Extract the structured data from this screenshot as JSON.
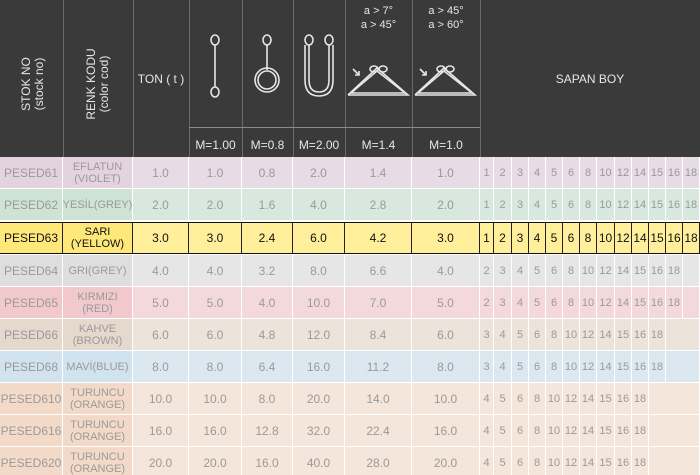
{
  "header": {
    "stok_no": "STOK NO",
    "stok_no_en": "(stock no)",
    "renk_kodu": "RENK KODU",
    "renk_kodu_en": "(color cod)",
    "ton": "TON ( t )",
    "angle_a1": "a > 7°",
    "angle_a2": "a > 45°",
    "angle_b1": "a > 45°",
    "angle_b2": "a > 60°",
    "sapan_boy": "SAPAN BOY",
    "m_values": [
      "M=1.00",
      "M=0.8",
      "M=2.00",
      "M=1.4",
      "M=1.0"
    ]
  },
  "colors": {
    "header_bg": "#3a3a3a",
    "highlight_bg": "#ffe87a",
    "highlight_border": "#111111"
  },
  "rows": [
    {
      "stock": "PESED61",
      "color1": "EFLATUN",
      "color2": "(VIOLET)",
      "ton": "1.0",
      "m": [
        "1.0",
        "0.8",
        "2.0",
        "1.4",
        "1.0"
      ],
      "lengths": [
        "1",
        "2",
        "3",
        "4",
        "5",
        "6",
        "8",
        "10",
        "12",
        "14",
        "15",
        "16",
        "18"
      ],
      "bg": "#e7dbe6",
      "cbg": "#e3d3e0"
    },
    {
      "stock": "PESED62",
      "color1": "YESİL(GREY)",
      "color2": "",
      "ton": "2.0",
      "m": [
        "2.0",
        "1.6",
        "4.0",
        "2.8",
        "2.0"
      ],
      "lengths": [
        "1",
        "2",
        "3",
        "4",
        "5",
        "6",
        "8",
        "10",
        "12",
        "14",
        "15",
        "16",
        "18"
      ],
      "bg": "#d9e8de",
      "cbg": "#cfe3d4"
    },
    {
      "stock": "PESED63",
      "color1": "SARI",
      "color2": "(YELLOW)",
      "ton": "3.0",
      "m": [
        "3.0",
        "2.4",
        "6.0",
        "4.2",
        "3.0"
      ],
      "lengths": [
        "1",
        "2",
        "3",
        "4",
        "5",
        "6",
        "8",
        "10",
        "12",
        "14",
        "15",
        "16",
        "18"
      ],
      "bg": "#ffef9a",
      "cbg": "#ffe87a"
    },
    {
      "stock": "PESED64",
      "color1": "GRI(GREY)",
      "color2": "",
      "ton": "4.0",
      "m": [
        "4.0",
        "3.2",
        "8.0",
        "6.6",
        "4.0"
      ],
      "lengths": [
        "2",
        "3",
        "4",
        "5",
        "6",
        "8",
        "10",
        "12",
        "14",
        "15",
        "16",
        "18"
      ],
      "bg": "#e6e6e6",
      "cbg": "#dedede"
    },
    {
      "stock": "PESED65",
      "color1": "KIRMIZI",
      "color2": "(RED)",
      "ton": "5.0",
      "m": [
        "5.0",
        "4.0",
        "10.0",
        "7.0",
        "5.0"
      ],
      "lengths": [
        "2",
        "3",
        "4",
        "5",
        "6",
        "8",
        "10",
        "12",
        "14",
        "15",
        "16",
        "18"
      ],
      "bg": "#f4d9dc",
      "cbg": "#f1c9cd"
    },
    {
      "stock": "PESED66",
      "color1": "KAHVE",
      "color2": "(BROWN)",
      "ton": "6.0",
      "m": [
        "6.0",
        "4.8",
        "12.0",
        "8.4",
        "6.0"
      ],
      "lengths": [
        "3",
        "4",
        "5",
        "6",
        "8",
        "10",
        "12",
        "14",
        "15",
        "16",
        "18"
      ],
      "bg": "#ece3da",
      "cbg": "#e5d8cc"
    },
    {
      "stock": "PESED68",
      "color1": "MAVİ(BLUE)",
      "color2": "",
      "ton": "8.0",
      "m": [
        "8.0",
        "6.4",
        "16.0",
        "11.2",
        "8.0"
      ],
      "lengths": [
        "3",
        "4",
        "5",
        "6",
        "8",
        "10",
        "12",
        "14",
        "15",
        "16",
        "18"
      ],
      "bg": "#dce8ef",
      "cbg": "#d0e3ee"
    },
    {
      "stock": "PESED610",
      "color1": "TURUNCU",
      "color2": "(ORANGE)",
      "ton": "10.0",
      "m": [
        "10.0",
        "8.0",
        "20.0",
        "14.0",
        "10.0"
      ],
      "lengths": [
        "4",
        "5",
        "6",
        "8",
        "10",
        "12",
        "14",
        "15",
        "16",
        "18"
      ],
      "bg": "#f5e6db",
      "cbg": "#f3dac8"
    },
    {
      "stock": "PESED616",
      "color1": "TURUNCU",
      "color2": "(ORANGE)",
      "ton": "16.0",
      "m": [
        "16.0",
        "12.8",
        "32.0",
        "22.4",
        "16.0"
      ],
      "lengths": [
        "4",
        "5",
        "6",
        "8",
        "10",
        "12",
        "14",
        "15",
        "16",
        "18"
      ],
      "bg": "#f5e6db",
      "cbg": "#f3dac8"
    },
    {
      "stock": "PESED620",
      "color1": "TURUNCU",
      "color2": "(ORANGE)",
      "ton": "20.0",
      "m": [
        "20.0",
        "16.0",
        "40.0",
        "28.0",
        "20.0"
      ],
      "lengths": [
        "4",
        "5",
        "6",
        "8",
        "10",
        "12",
        "14",
        "15",
        "16",
        "18"
      ],
      "bg": "#f5e6db",
      "cbg": "#f3dac8"
    }
  ]
}
